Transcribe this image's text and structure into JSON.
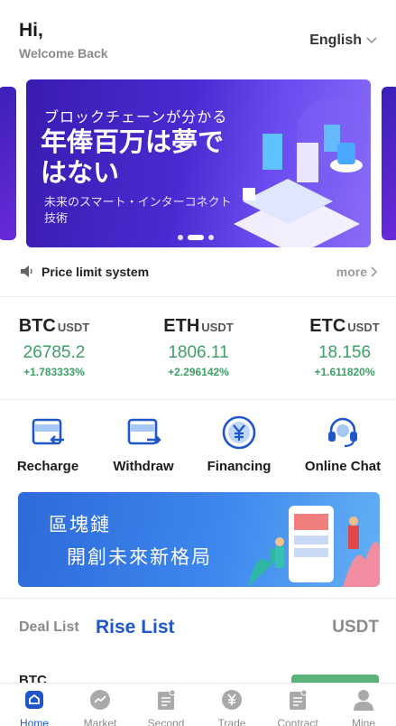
{
  "header": {
    "greeting": "Hi,",
    "subtitle": "Welcome Back",
    "language": "English"
  },
  "banner": {
    "line1": "ブロックチェーンが分かる",
    "line2": "年俸百万は夢ではない",
    "line3": "未来のスマート・インターコネクト技術",
    "dots": 3,
    "active_dot": 1
  },
  "notice": {
    "text": "Price limit system",
    "more": "more"
  },
  "tickers": [
    {
      "symbol": "BTC",
      "quote": "USDT",
      "price": "26785.2",
      "change": "+1.783333%"
    },
    {
      "symbol": "ETH",
      "quote": "USDT",
      "price": "1806.11",
      "change": "+2.296142%"
    },
    {
      "symbol": "ETC",
      "quote": "USDT",
      "price": "18.156",
      "change": "+1.611820%"
    }
  ],
  "actions": [
    {
      "label": "Recharge",
      "icon": "recharge-icon"
    },
    {
      "label": "Withdraw",
      "icon": "withdraw-icon"
    },
    {
      "label": "Financing",
      "icon": "financing-yen-icon"
    },
    {
      "label": "Online Chat",
      "icon": "headset-icon"
    }
  ],
  "promo": {
    "line1": "區塊鏈",
    "line2": "開創未來新格局"
  },
  "list_tabs": {
    "deal": "Deal List",
    "rise": "Rise List",
    "quote": "USDT"
  },
  "list_rows": [
    {
      "name": "BTC"
    }
  ],
  "bottom_nav": [
    {
      "label": "Home",
      "icon": "home-icon",
      "active": true
    },
    {
      "label": "Market",
      "icon": "market-icon",
      "active": false
    },
    {
      "label": "Second",
      "icon": "second-icon",
      "active": false
    },
    {
      "label": "Trade",
      "icon": "trade-icon",
      "active": false
    },
    {
      "label": "Contract",
      "icon": "contract-icon",
      "active": false
    },
    {
      "label": "Mine",
      "icon": "user-icon",
      "active": false
    }
  ],
  "colors": {
    "accent": "#1f57c9",
    "up": "#3e9e66",
    "muted": "#8a8a8a"
  }
}
